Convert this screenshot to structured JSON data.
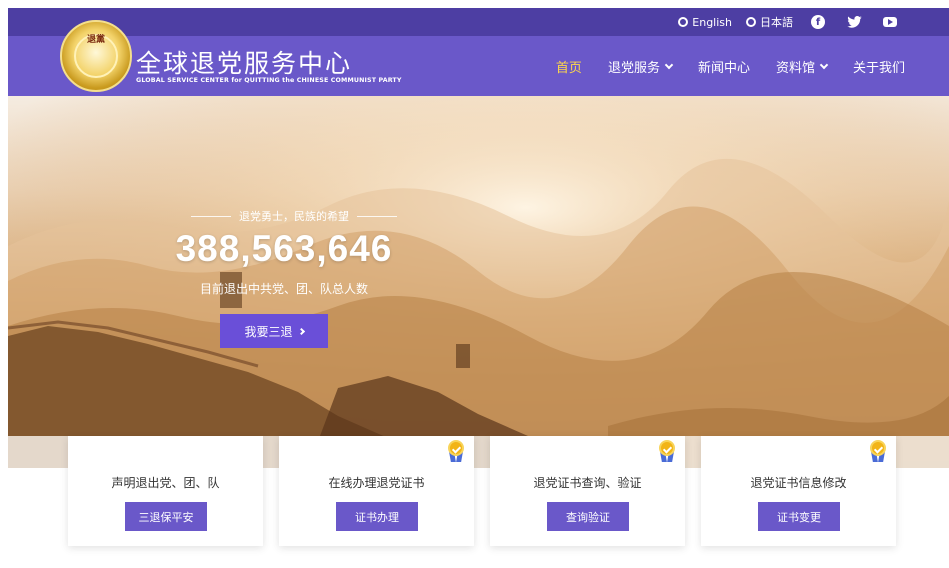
{
  "topbar": {
    "languages": [
      {
        "label": "English",
        "icon": "globe-icon"
      },
      {
        "label": "日本語",
        "icon": "globe-icon"
      }
    ],
    "social": [
      "facebook-icon",
      "twitter-icon",
      "youtube-icon"
    ]
  },
  "brand": {
    "title": "全球退党服务中心",
    "subtitle": "GLOBAL SERVICE CENTER for QUITTING the CHINESE COMMUNIST PARTY",
    "seal_text": "退黨"
  },
  "nav": [
    {
      "label": "首页",
      "active": true,
      "dropdown": false
    },
    {
      "label": "退党服务",
      "active": false,
      "dropdown": true
    },
    {
      "label": "新闻中心",
      "active": false,
      "dropdown": false
    },
    {
      "label": "资料馆",
      "active": false,
      "dropdown": true
    },
    {
      "label": "关于我们",
      "active": false,
      "dropdown": false
    }
  ],
  "hero": {
    "tagline": "退党勇士，民族的希望",
    "count": "388,563,646",
    "count_label": "目前退出中共党、团、队总人数",
    "cta_label": "我要三退"
  },
  "cards": [
    {
      "title": "声明退出党、团、队",
      "button": "三退保平安",
      "badge": false
    },
    {
      "title": "在线办理退党证书",
      "button": "证书办理",
      "badge": true
    },
    {
      "title": "退党证书查询、验证",
      "button": "查询验证",
      "badge": true
    },
    {
      "title": "退党证书信息修改",
      "button": "证书变更",
      "badge": true
    }
  ],
  "colors": {
    "topbar": "#4d3ea3",
    "header": "#6a58c9",
    "active_nav": "#ffd84a",
    "cta": "#6a4fd8",
    "card_button": "#6a58c9",
    "badge_gold": "#f2b417"
  }
}
